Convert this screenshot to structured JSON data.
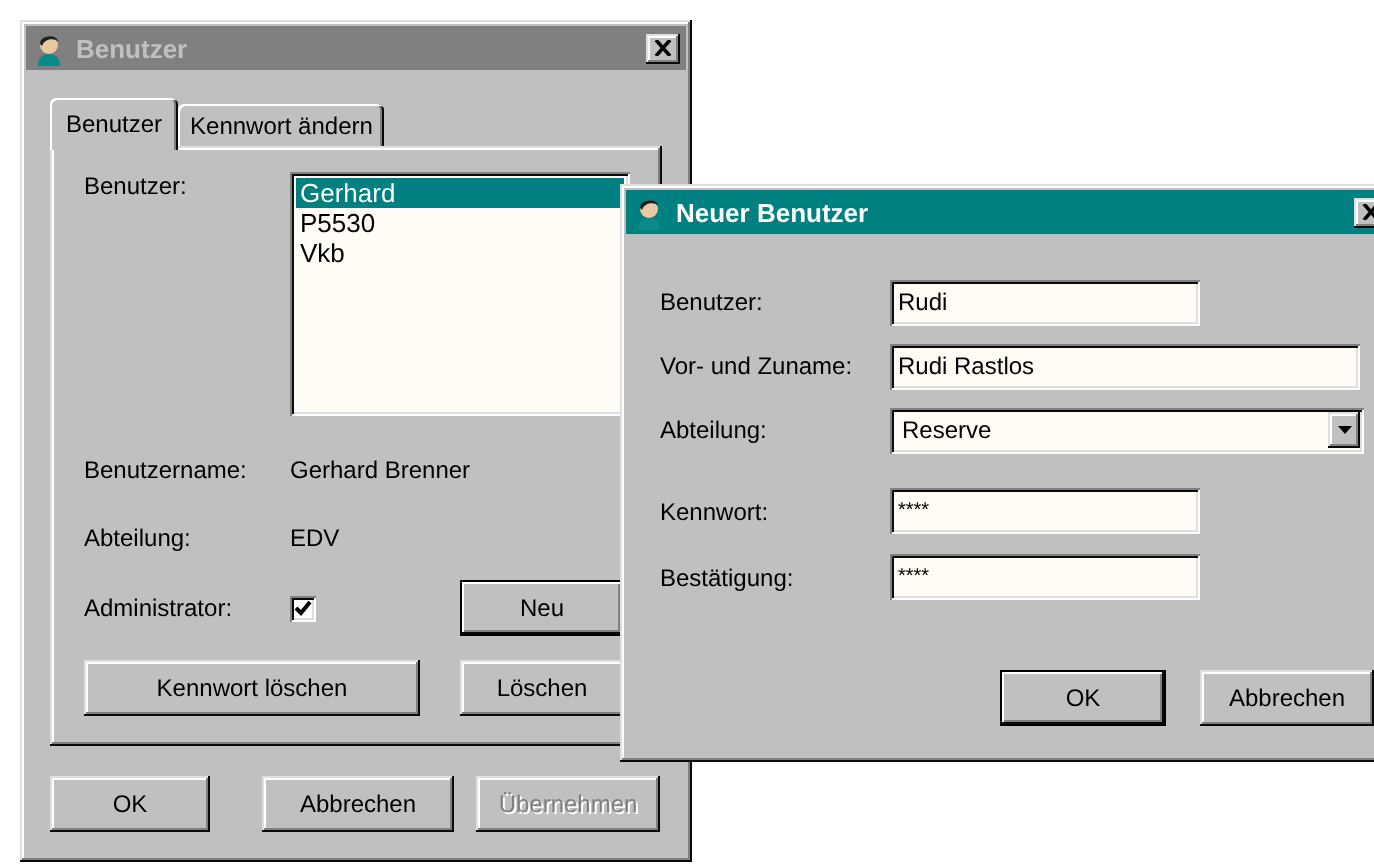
{
  "main_window": {
    "title": "Benutzer",
    "active": false,
    "tabs": [
      {
        "label": "Benutzer",
        "selected": true
      },
      {
        "label": "Kennwort ändern",
        "selected": false
      }
    ],
    "user_label": "Benutzer:",
    "user_list": [
      {
        "label": "Gerhard",
        "selected": true
      },
      {
        "label": "P5530",
        "selected": false
      },
      {
        "label": "Vkb",
        "selected": false
      }
    ],
    "details": [
      {
        "label": "Benutzername:",
        "value": "Gerhard Brenner"
      },
      {
        "label": "Abteilung:",
        "value": "EDV"
      }
    ],
    "administrator": {
      "label": "Administrator:",
      "checked": true
    },
    "new_button": {
      "label": "Neu",
      "default": true
    },
    "panel_buttons": [
      {
        "label": "Kennwort löschen"
      },
      {
        "label": "Löschen"
      }
    ],
    "footer_buttons": [
      {
        "label": "OK",
        "disabled": false
      },
      {
        "label": "Abbrechen",
        "disabled": false
      },
      {
        "label": "Übernehmen",
        "disabled": true
      }
    ]
  },
  "dialog": {
    "title": "Neuer Benutzer",
    "active": true,
    "fields": [
      {
        "kind": "text",
        "label": "Benutzer:",
        "value": "Rudi"
      },
      {
        "kind": "text",
        "label": "Vor- und Zuname:",
        "value": "Rudi Rastlos"
      },
      {
        "kind": "dropdown",
        "label": "Abteilung:",
        "value": "Reserve"
      }
    ],
    "password_fields": [
      {
        "label": "Kennwort:",
        "value": "****"
      },
      {
        "label": "Bestätigung:",
        "value": "****"
      }
    ],
    "buttons": [
      {
        "label": "OK",
        "default": true
      },
      {
        "label": "Abbrechen",
        "default": false
      }
    ]
  }
}
